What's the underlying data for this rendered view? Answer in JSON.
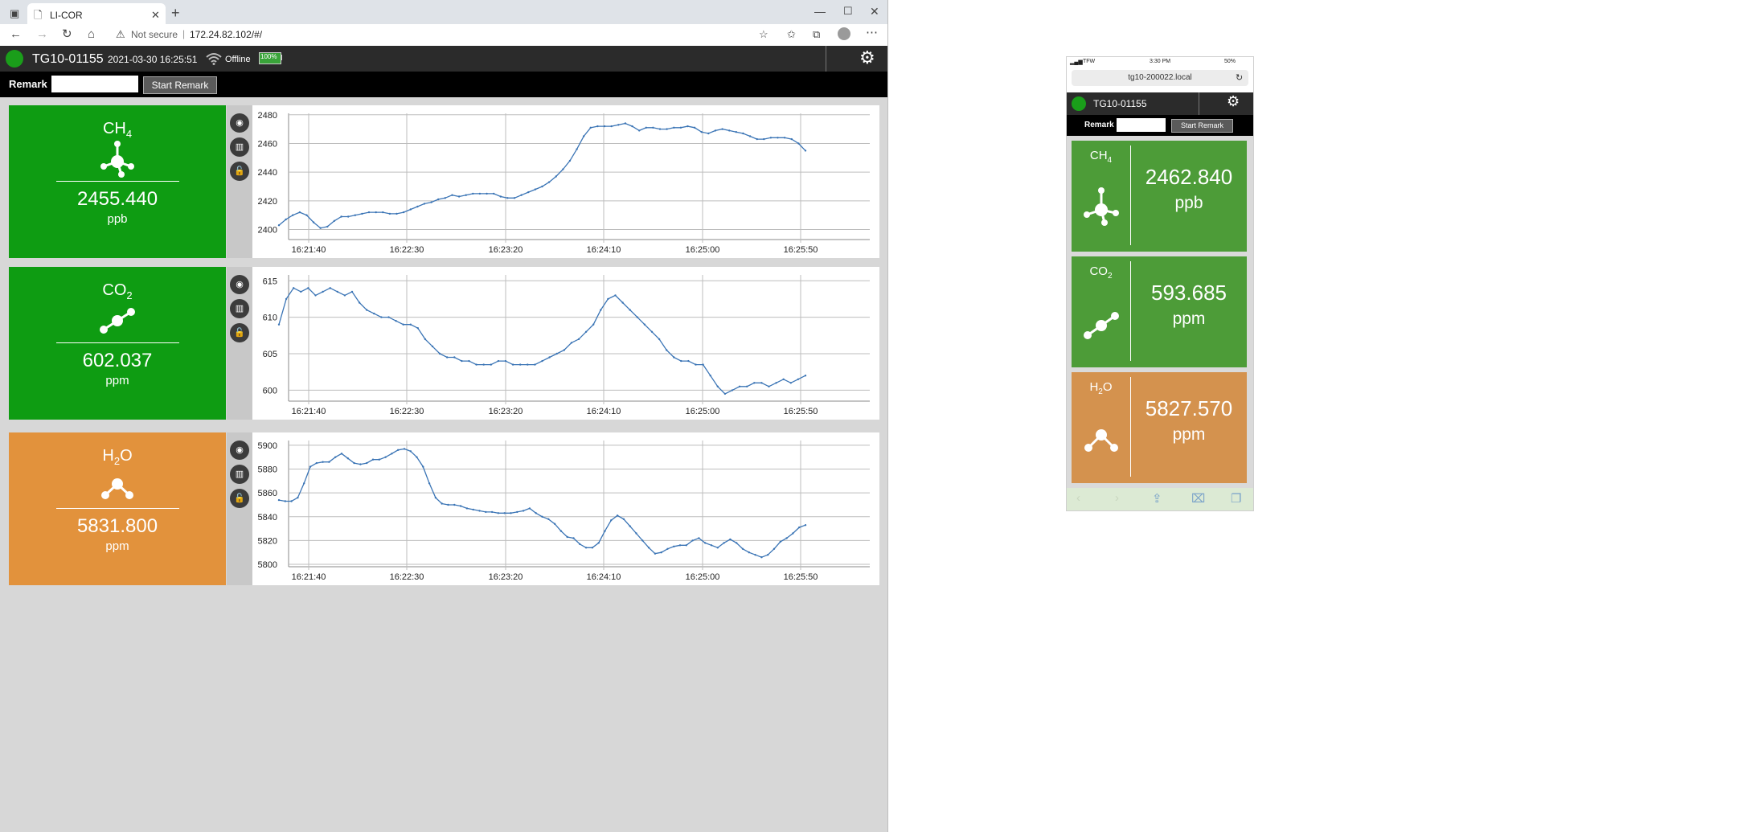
{
  "browser": {
    "tab_title": "LI-COR",
    "not_secure": "Not secure",
    "url": "172.24.82.102/#/"
  },
  "app": {
    "device_id": "TG10-01155",
    "datetime": "2021-03-30 16:25:51",
    "status": "Offline",
    "battery": "100%",
    "remark_label": "Remark",
    "start_remark": "Start Remark",
    "status_color": "#1a9e1a"
  },
  "gases": [
    {
      "name": "CH",
      "sub": "4",
      "value": "2455.440",
      "unit": "ppb",
      "color": "#0e9c12"
    },
    {
      "name": "CO",
      "sub": "2",
      "value": "602.037",
      "unit": "ppm",
      "color": "#0e9c12"
    },
    {
      "name": "H",
      "sub": "2",
      "name2": "O",
      "value": "5831.800",
      "unit": "ppm",
      "color": "#e2923c"
    }
  ],
  "chart_data": [
    {
      "type": "line",
      "series": [
        {
          "values": [
            2403,
            2407,
            2410,
            2412,
            2410,
            2405,
            2401,
            2402,
            2406,
            2409,
            2409,
            2410,
            2411,
            2412,
            2412,
            2412,
            2411,
            2411,
            2412,
            2414,
            2416,
            2418,
            2419,
            2421,
            2422,
            2424,
            2423,
            2424,
            2425,
            2425,
            2425,
            2425,
            2423,
            2422,
            2422,
            2424,
            2426,
            2428,
            2430,
            2433,
            2437,
            2442,
            2448,
            2456,
            2465,
            2471,
            2472,
            2472,
            2472,
            2473,
            2474,
            2472,
            2469,
            2471,
            2471,
            2470,
            2470,
            2471,
            2471,
            2472,
            2471,
            2468,
            2467,
            2469,
            2470,
            2469,
            2468,
            2467,
            2465,
            2463,
            2463,
            2464,
            2464,
            2464,
            2463,
            2460,
            2455
          ]
        }
      ],
      "x_ticks": [
        "16:21:40",
        "16:22:30",
        "16:23:20",
        "16:24:10",
        "16:25:00",
        "16:25:50"
      ],
      "y_ticks": [
        2400,
        2420,
        2440,
        2460,
        2480
      ],
      "ylim": [
        2393,
        2481
      ],
      "grid": true
    },
    {
      "type": "line",
      "series": [
        {
          "values": [
            609,
            612.5,
            614,
            613.5,
            614,
            613,
            613.5,
            614,
            613.5,
            613,
            613.5,
            612,
            611,
            610.5,
            610,
            610,
            609.5,
            609,
            609,
            608.5,
            607,
            606,
            605,
            604.5,
            604.5,
            604,
            604,
            603.5,
            603.5,
            603.5,
            604,
            604,
            603.5,
            603.5,
            603.5,
            603.5,
            604,
            604.5,
            605,
            605.5,
            606.5,
            607,
            608,
            609,
            611,
            612.5,
            613,
            612,
            611,
            610,
            609,
            608,
            607,
            605.5,
            604.5,
            604,
            604,
            603.5,
            603.5,
            602,
            600.5,
            599.5,
            600,
            600.5,
            600.5,
            601,
            601,
            600.5,
            601,
            601.5,
            601,
            601.5,
            602
          ]
        }
      ],
      "x_ticks": [
        "16:21:40",
        "16:22:30",
        "16:23:20",
        "16:24:10",
        "16:25:00",
        "16:25:50"
      ],
      "y_ticks": [
        600,
        605,
        610,
        615
      ],
      "ylim": [
        598.5,
        615.8
      ],
      "grid": true
    },
    {
      "type": "line",
      "series": [
        {
          "values": [
            5854,
            5853,
            5853,
            5856,
            5868,
            5882,
            5885,
            5886,
            5886,
            5890,
            5893,
            5889,
            5885,
            5884,
            5885,
            5888,
            5888,
            5890,
            5893,
            5896,
            5897,
            5895,
            5890,
            5882,
            5868,
            5856,
            5851,
            5850,
            5850,
            5849,
            5847,
            5846,
            5845,
            5844,
            5844,
            5843,
            5843,
            5843,
            5844,
            5845,
            5847,
            5843,
            5840,
            5838,
            5834,
            5828,
            5823,
            5822,
            5817,
            5814,
            5814,
            5818,
            5828,
            5837,
            5841,
            5838,
            5832,
            5826,
            5820,
            5814,
            5809,
            5810,
            5813,
            5815,
            5816,
            5816,
            5820,
            5822,
            5818,
            5816,
            5814,
            5818,
            5821,
            5818,
            5813,
            5810,
            5808,
            5806,
            5808,
            5813,
            5819,
            5822,
            5826,
            5831,
            5833
          ]
        }
      ],
      "x_ticks": [
        "16:21:40",
        "16:22:30",
        "16:23:20",
        "16:24:10",
        "16:25:00",
        "16:25:50"
      ],
      "y_ticks": [
        5800,
        5820,
        5840,
        5860,
        5880,
        5900
      ],
      "ylim": [
        5798,
        5904
      ],
      "grid": true
    }
  ],
  "phone": {
    "carrier": "TFW",
    "time": "3:30 PM",
    "battery": "50%",
    "url": "tg10-200022.local",
    "device_id": "TG10-01155",
    "remark_label": "Remark",
    "start_remark": "Start Remark",
    "gases": [
      {
        "name": "CH",
        "sub": "4",
        "value": "2462.840",
        "unit": "ppb",
        "color": "#4d9c38"
      },
      {
        "name": "CO",
        "sub": "2",
        "value": "593.685",
        "unit": "ppm",
        "color": "#4d9c38"
      },
      {
        "name": "H",
        "sub": "2",
        "name2": "O",
        "value": "5827.570",
        "unit": "ppm",
        "color": "#d4924e"
      }
    ]
  },
  "colors": {
    "line": "#3a74b5",
    "grid": "#bdbdbd"
  }
}
